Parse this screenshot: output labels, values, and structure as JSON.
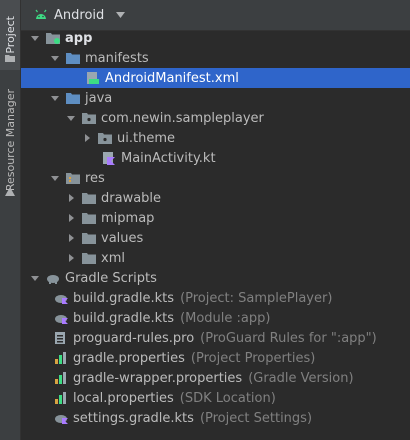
{
  "toolstrip": {
    "project_label": "Project",
    "resource_manager_label": "Resource Manager"
  },
  "header": {
    "view_selector": "Android"
  },
  "tree": {
    "app": "app",
    "manifests": "manifests",
    "manifest_file": "AndroidManifest.xml",
    "java": "java",
    "package": "com.newin.sampleplayer",
    "ui_theme": "ui.theme",
    "main_activity": "MainActivity.kt",
    "res": "res",
    "drawable": "drawable",
    "mipmap": "mipmap",
    "values": "values",
    "xml": "xml",
    "gradle_scripts": "Gradle Scripts",
    "gradle_files": [
      {
        "name": "build.gradle.kts",
        "detail": "(Project: SamplePlayer)"
      },
      {
        "name": "build.gradle.kts",
        "detail": "(Module :app)"
      },
      {
        "name": "proguard-rules.pro",
        "detail": "(ProGuard Rules for \":app\")"
      },
      {
        "name": "gradle.properties",
        "detail": "(Project Properties)"
      },
      {
        "name": "gradle-wrapper.properties",
        "detail": "(Gradle Version)"
      },
      {
        "name": "local.properties",
        "detail": "(SDK Location)"
      },
      {
        "name": "settings.gradle.kts",
        "detail": "(Project Settings)"
      }
    ]
  },
  "colors": {
    "selection": "#2f65ca",
    "android_green": "#3ddc84",
    "folder_blue": "#5e8ec2"
  }
}
